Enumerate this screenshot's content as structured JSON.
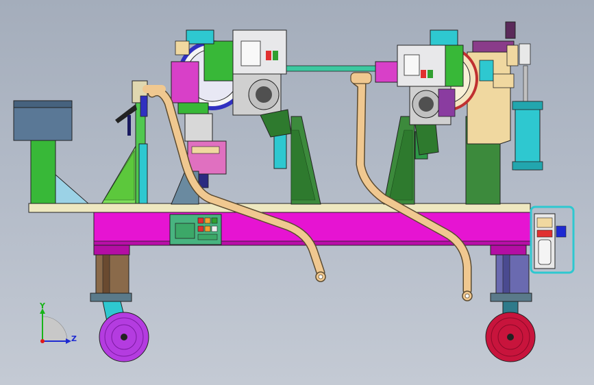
{
  "viewport": {
    "background_top": "#a4adbb",
    "background_bottom": "#c4cad4"
  },
  "triad": {
    "y_label": "Y",
    "z_label": "Z",
    "y_color": "#18b418",
    "z_color": "#1e2ad2",
    "x_color": "#e01818"
  },
  "colors": {
    "frame_magenta": "#e614d2",
    "deck": "#eee8c0",
    "tube": "#f0c890",
    "green": "#3cc83c",
    "wheel_left": "#b43ce0",
    "wheel_right": "#c8143c",
    "cyan": "#2ec8d0",
    "tan": "#f0d8a0",
    "cabinet": "#5a7896"
  }
}
